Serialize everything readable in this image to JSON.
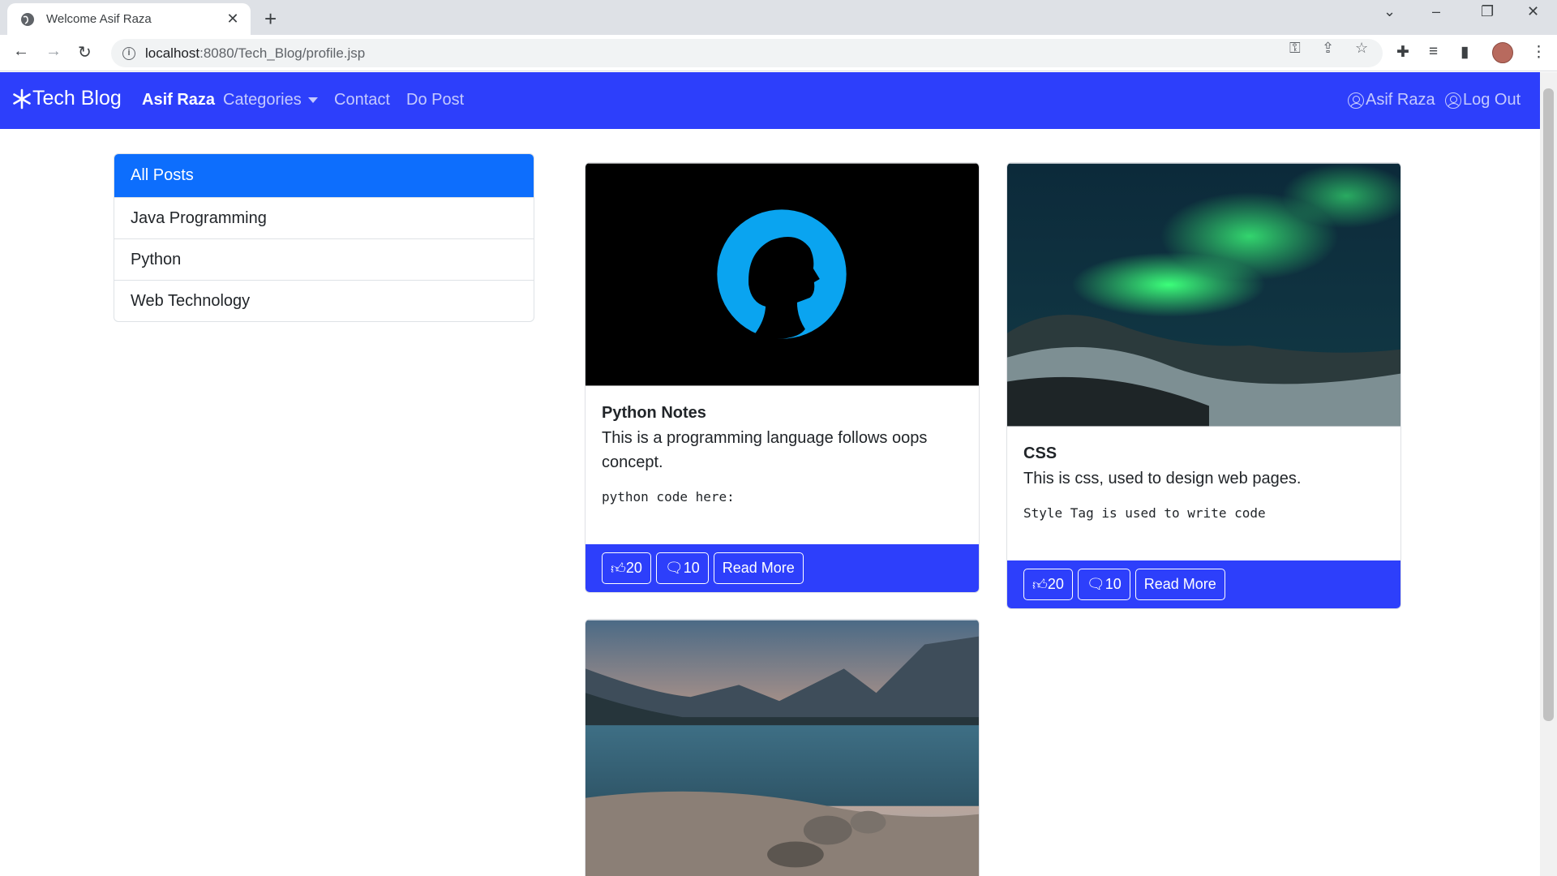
{
  "browser": {
    "tab_title": "Welcome Asif Raza",
    "url_host": "localhost",
    "url_port_path": ":8080/Tech_Blog/profile.jsp"
  },
  "navbar": {
    "brand": "Tech Blog",
    "links": [
      "Asif Raza",
      "Categories",
      "Contact",
      "Do Post"
    ],
    "right": [
      "Asif Raza",
      "Log Out"
    ],
    "color": "#2d3ffb"
  },
  "sidebar": {
    "items": [
      "All Posts",
      "Java Programming",
      "Python",
      "Web Technology"
    ],
    "active_color": "#0d6efd"
  },
  "posts": [
    {
      "title": "Python Notes",
      "text": "This is a programming language follows oops concept.",
      "code": "python code here:",
      "likes": "20",
      "comments": "10",
      "read_more": "Read More",
      "image": "silhouette-portrait"
    },
    {
      "title": "CSS",
      "text": "This is css, used to design web pages.",
      "code": "Style Tag is used to write code",
      "likes": "20",
      "comments": "10",
      "read_more": "Read More",
      "image": "aurora-mountains"
    },
    {
      "image": "mountain-lake"
    }
  ]
}
